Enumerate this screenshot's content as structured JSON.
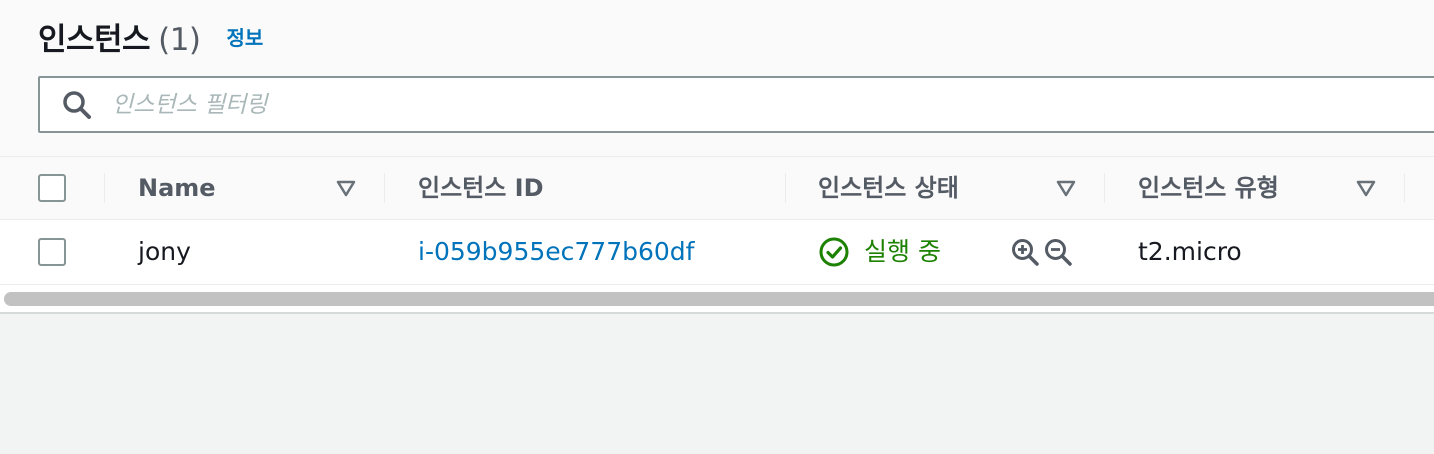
{
  "header": {
    "title": "인스턴스",
    "count": "(1)",
    "info_link": "정보"
  },
  "search": {
    "placeholder": "인스턴스 필터링",
    "value": ""
  },
  "table": {
    "columns": [
      "Name",
      "인스턴스 ID",
      "인스턴스 상태",
      "인스턴스 유형"
    ],
    "rows": [
      {
        "name": "jony",
        "instance_id": "i-059b955ec777b60df",
        "state": "실행 중",
        "type": "t2.micro"
      }
    ]
  },
  "colors": {
    "link": "#0073bb",
    "success": "#1d8102",
    "text": "#16191f",
    "muted": "#545b64"
  },
  "icons": [
    "search-icon",
    "filter-triangle-icon",
    "status-success-icon",
    "zoom-in-icon",
    "zoom-out-icon"
  ]
}
